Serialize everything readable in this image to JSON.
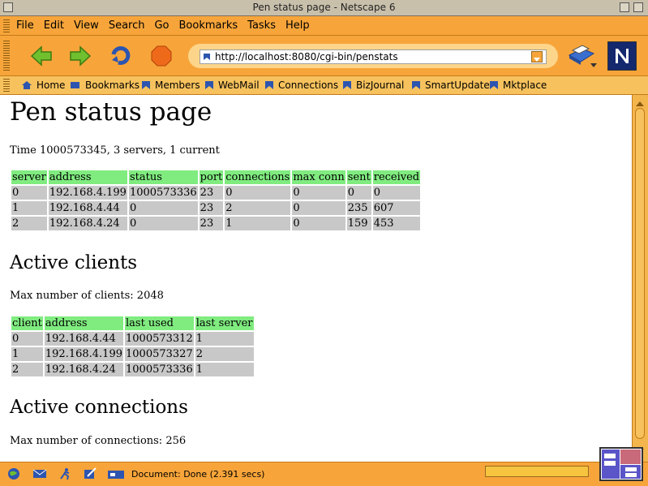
{
  "window": {
    "title": "Pen status page - Netscape 6"
  },
  "menu": [
    "File",
    "Edit",
    "View",
    "Search",
    "Go",
    "Bookmarks",
    "Tasks",
    "Help"
  ],
  "url": {
    "value": "http://localhost:8080/cgi-bin/penstats"
  },
  "personal_toolbar": [
    "Home",
    "Bookmarks",
    "Members",
    "WebMail",
    "Connections",
    "BizJournal",
    "SmartUpdate",
    "Mktplace"
  ],
  "page": {
    "heading": "Pen status page",
    "summary": "Time 1000573345, 3 servers, 1 current",
    "servers": {
      "headers": [
        "server",
        "address",
        "status",
        "port",
        "connections",
        "max conn",
        "sent",
        "received"
      ],
      "rows": [
        [
          "0",
          "192.168.4.199",
          "1000573336",
          "23",
          "0",
          "0",
          "0",
          "0"
        ],
        [
          "1",
          "192.168.4.44",
          "0",
          "23",
          "2",
          "0",
          "235",
          "607"
        ],
        [
          "2",
          "192.168.4.24",
          "0",
          "23",
          "1",
          "0",
          "159",
          "453"
        ]
      ]
    },
    "clients_heading": "Active clients",
    "clients_max": "Max number of clients: 2048",
    "clients": {
      "headers": [
        "client",
        "address",
        "last used",
        "last server"
      ],
      "rows": [
        [
          "0",
          "192.168.4.44",
          "1000573312",
          "1"
        ],
        [
          "1",
          "192.168.4.199",
          "1000573327",
          "2"
        ],
        [
          "2",
          "192.168.4.24",
          "1000573336",
          "1"
        ]
      ]
    },
    "connections_heading": "Active connections",
    "connections_max": "Max number of connections: 256"
  },
  "status": {
    "text": "Document: Done (2.391 secs)"
  },
  "colors": {
    "chrome": "#f7a53a",
    "header_cell": "#80ec80",
    "data_cell": "#c8c8c8"
  }
}
